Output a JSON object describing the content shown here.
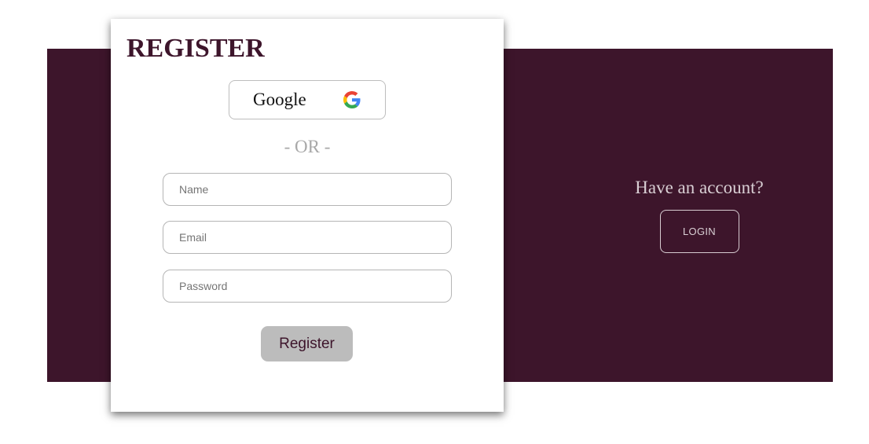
{
  "register_card": {
    "title": "REGISTER",
    "google_button": {
      "label": "Google",
      "icon": "google-g-icon"
    },
    "divider_text": "- OR -",
    "fields": {
      "name_placeholder": "Name",
      "email_placeholder": "Email",
      "password_placeholder": "Password"
    },
    "submit_label": "Register"
  },
  "side_panel": {
    "question": "Have an account?",
    "login_label": "LOGIN"
  },
  "colors": {
    "brand": "#3d152b",
    "button_gray": "#bcbcbc",
    "muted_text": "#a8a8a8",
    "panel_text": "#d9cfd4"
  }
}
